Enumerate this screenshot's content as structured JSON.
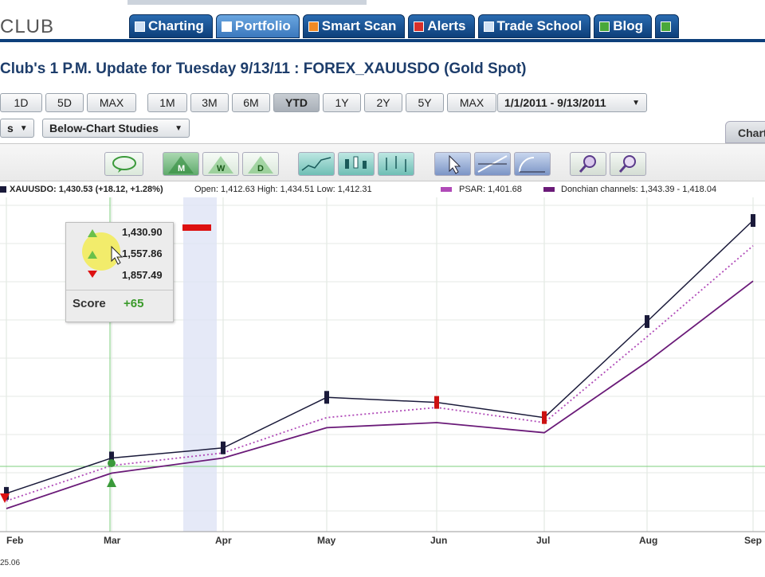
{
  "header": {
    "logo_text": "CLUB",
    "tabs": [
      {
        "label": "Charting",
        "icon": "chart-icon"
      },
      {
        "label": "Portfolio",
        "icon": "portfolio-icon"
      },
      {
        "label": "Smart Scan",
        "icon": "smart-scan-icon"
      },
      {
        "label": "Alerts",
        "icon": "alerts-icon"
      },
      {
        "label": "Trade School",
        "icon": "trade-school-icon"
      },
      {
        "label": "Blog",
        "icon": "blog-icon"
      }
    ]
  },
  "page_title": "Club's  1 P.M.  Update for Tuesday  9/13/11 : FOREX_XAUUSDO (Gold Spot)",
  "period_buttons_a": [
    "1D",
    "5D",
    "MAX"
  ],
  "period_buttons_b": [
    "1M",
    "3M",
    "6M",
    "YTD",
    "1Y",
    "2Y",
    "5Y",
    "MAX"
  ],
  "selected_period": "YTD",
  "date_range": "1/1/2011 - 9/13/2011",
  "studies_dropdowns": {
    "left_label": "s",
    "below_chart": "Below-Chart Studies"
  },
  "chart_tab_label": "Chart",
  "legend": {
    "symbol": "XAUUSDO: 1,430.53 (+18.12, +1.28%)",
    "ohlc": "Open: 1,412.63  High: 1,434.51  Low: 1,412.31",
    "psar": "PSAR: 1,401.68",
    "donchian": "Donchian channels: 1,343.39 - 1,418.04"
  },
  "scorebox": {
    "levels": [
      "1,430.90",
      "1,557.86",
      "1,857.49"
    ],
    "score_label": "Score",
    "score_value": "+65"
  },
  "footer_value": "25.06",
  "colors": {
    "up": "#1a1a3a",
    "down": "#cc1111",
    "psar": "#b04ab8",
    "donchian": "#6a1a78",
    "nav": "#0d3f7a"
  },
  "chart_data": {
    "type": "line",
    "title": "",
    "x": [
      "Feb",
      "Mar",
      "Apr",
      "May",
      "Jun",
      "Jul",
      "Aug",
      "Sep"
    ],
    "series": [
      {
        "name": "XAUUSDO",
        "values": [
          1340,
          1410,
          1430,
          1530,
          1520,
          1490,
          1680,
          1880
        ]
      },
      {
        "name": "PSAR",
        "values": [
          1325,
          1395,
          1420,
          1490,
          1510,
          1480,
          1650,
          1830
        ]
      },
      {
        "name": "Donchian channels",
        "values": [
          1310,
          1380,
          1410,
          1470,
          1480,
          1460,
          1600,
          1760
        ]
      }
    ]
  }
}
